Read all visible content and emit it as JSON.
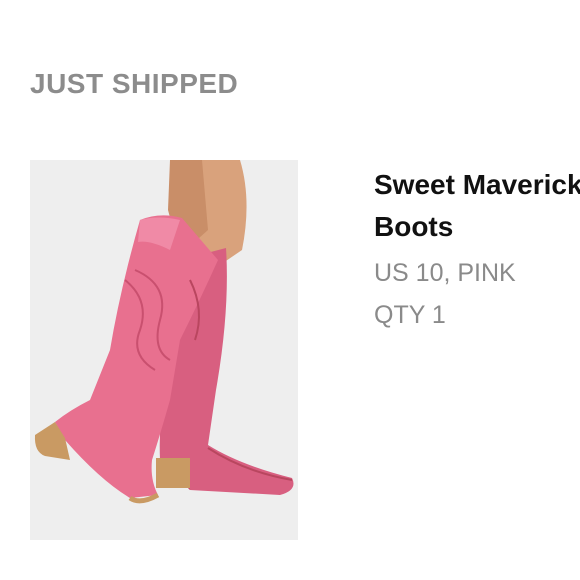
{
  "header": {
    "status": "JUST SHIPPED"
  },
  "product": {
    "name": "Sweet Maverick Boots",
    "variant": "US 10, PINK",
    "quantity": "QTY 1",
    "image_icon": "pink-cowboy-boots-photo",
    "colors": {
      "boot": "#e8708f",
      "boot_shadow": "#c9506f",
      "heel": "#c99a63",
      "skin": "#d9a27c",
      "image_bg": "#eeeeee"
    }
  }
}
